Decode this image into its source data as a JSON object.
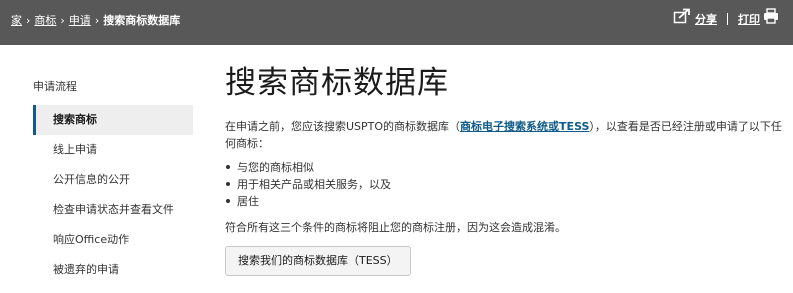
{
  "breadcrumb": {
    "items": [
      "家",
      "商标",
      "申请"
    ],
    "separator": "›",
    "current": "搜索商标数据库"
  },
  "top_actions": {
    "share_label": "分享",
    "print_label": "打印"
  },
  "sidebar": {
    "heading": "申请流程",
    "items": [
      {
        "label": "搜索商标",
        "active": true
      },
      {
        "label": "线上申请",
        "active": false
      },
      {
        "label": "公开信息的公开",
        "active": false
      },
      {
        "label": "检查申请状态并查看文件",
        "active": false
      },
      {
        "label": "响应Office动作",
        "active": false
      },
      {
        "label": "被遗弃的申请",
        "active": false
      }
    ]
  },
  "main": {
    "title": "搜索商标数据库",
    "intro_before": "在申请之前，您应该搜索USPTO的商标数据库（",
    "intro_link": "商标电子搜索系统或TESS",
    "intro_after": "），以查看是否已经注册或申请了以下任何商标：",
    "criteria": [
      "与您的商标相似",
      "用于相关产品或相关服务，以及",
      "居住"
    ],
    "warning": "符合所有这三个条件的商标将阻止您的商标注册，因为这会造成混淆。",
    "search_button": "搜索我们的商标数据库（TESS）"
  },
  "colors": {
    "topbar_bg": "#585858",
    "link": "#0f5b8a",
    "active_item_bg": "#eeeeee",
    "active_item_border": "#0f5b8a"
  },
  "icons": {
    "share": "share-icon",
    "print": "printer-icon"
  }
}
